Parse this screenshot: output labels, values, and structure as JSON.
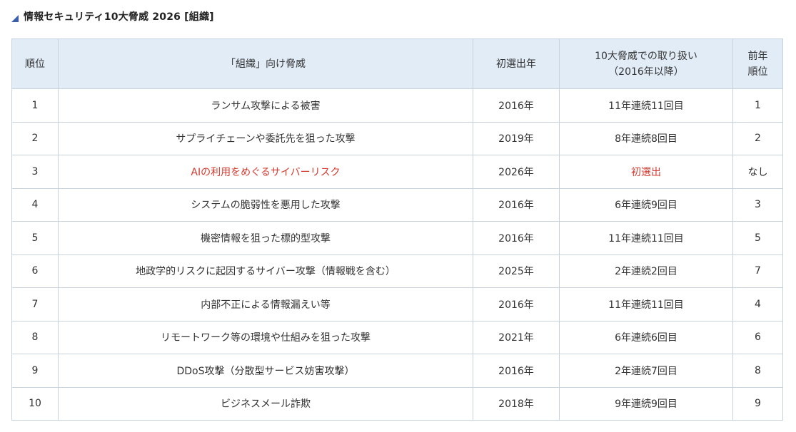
{
  "page": {
    "title": "情報セキュリティ10大脅威 2026 [組織]",
    "title_icon": "triangle-corner-icon",
    "accent_color": "#3b5fa8",
    "highlight_color": "#d43a2f",
    "header_bg": "#e1ecf7"
  },
  "table": {
    "headers": {
      "rank": "順位",
      "threat": "「組織」向け脅威",
      "first_selected": "初選出年",
      "history_line1": "10大脅威での取り扱い",
      "history_line2": "（2016年以降）",
      "prev_line1": "前年",
      "prev_line2": "順位"
    },
    "rows": [
      {
        "rank": "1",
        "threat": "ランサム攻撃による被害",
        "first": "2016年",
        "history": "11年連続11回目",
        "prev": "1"
      },
      {
        "rank": "2",
        "threat": "サプライチェーンや委託先を狙った攻撃",
        "first": "2019年",
        "history": "8年連続8回目",
        "prev": "2"
      },
      {
        "rank": "3",
        "threat": "AIの利用をめぐるサイバーリスク",
        "first": "2026年",
        "history": "初選出",
        "prev": "なし"
      },
      {
        "rank": "4",
        "threat": "システムの脆弱性を悪用した攻撃",
        "first": "2016年",
        "history": "6年連続9回目",
        "prev": "3"
      },
      {
        "rank": "5",
        "threat": "機密情報を狙った標的型攻撃",
        "first": "2016年",
        "history": "11年連続11回目",
        "prev": "5"
      },
      {
        "rank": "6",
        "threat": "地政学的リスクに起因するサイバー攻撃（情報戦を含む）",
        "first": "2025年",
        "history": "2年連続2回目",
        "prev": "7"
      },
      {
        "rank": "7",
        "threat": "内部不正による情報漏えい等",
        "first": "2016年",
        "history": "11年連続11回目",
        "prev": "4"
      },
      {
        "rank": "8",
        "threat": "リモートワーク等の環境や仕組みを狙った攻撃",
        "first": "2021年",
        "history": "6年連続6回目",
        "prev": "6"
      },
      {
        "rank": "9",
        "threat": "DDoS攻撃（分散型サービス妨害攻撃）",
        "first": "2016年",
        "history": "2年連続7回目",
        "prev": "8"
      },
      {
        "rank": "10",
        "threat": "ビジネスメール詐欺",
        "first": "2018年",
        "history": "9年連続9回目",
        "prev": "9"
      }
    ]
  }
}
